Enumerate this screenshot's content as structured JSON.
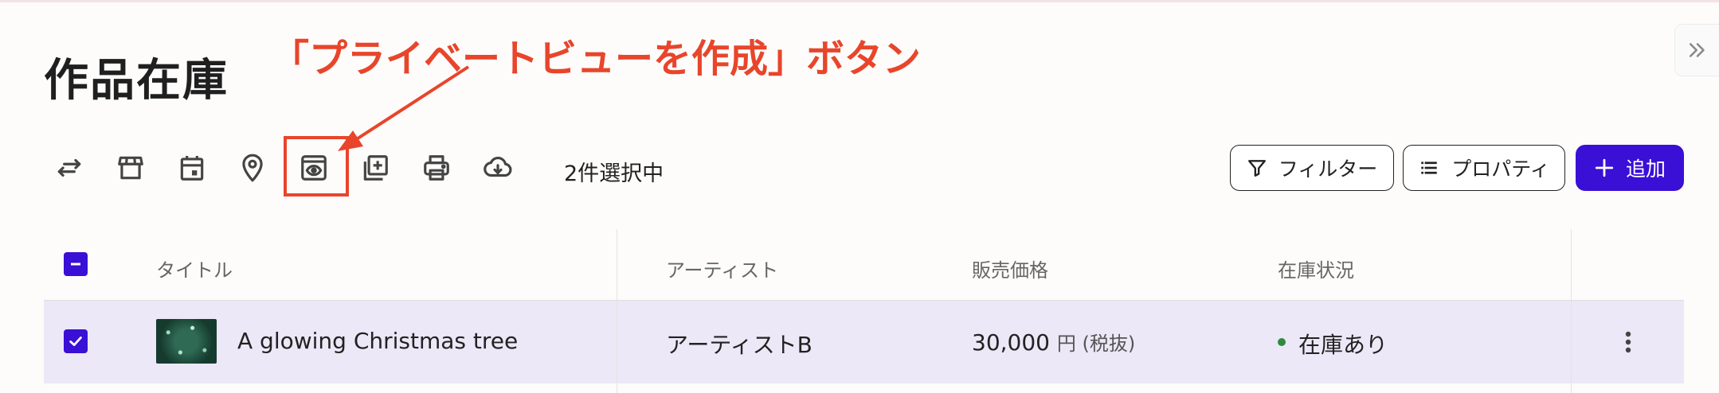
{
  "page": {
    "title": "作品在庫"
  },
  "annotation": {
    "label": "「プライベートビューを作成」ボタン",
    "color": "#e8452b"
  },
  "toolbar": {
    "icons": [
      "swap-icon",
      "store-icon",
      "calendar-icon",
      "location-pin-icon",
      "private-view-icon",
      "add-copy-icon",
      "print-icon",
      "cloud-download-icon"
    ],
    "selected_text": "2件選択中",
    "filter_label": "フィルター",
    "property_label": "プロパティ",
    "add_label": "追加"
  },
  "table": {
    "headers": [
      "タイトル",
      "アーティスト",
      "販売価格",
      "在庫状況"
    ],
    "rows": [
      {
        "title": "A glowing Christmas tree",
        "artist": "アーティストB",
        "price": "30,000",
        "price_unit": "円 (税抜)",
        "stock": "在庫あり",
        "selected": true
      }
    ]
  },
  "colors": {
    "accent": "#3a0fd6",
    "row_selected": "#ece8f7",
    "stock_ok": "#2e8b3d"
  }
}
